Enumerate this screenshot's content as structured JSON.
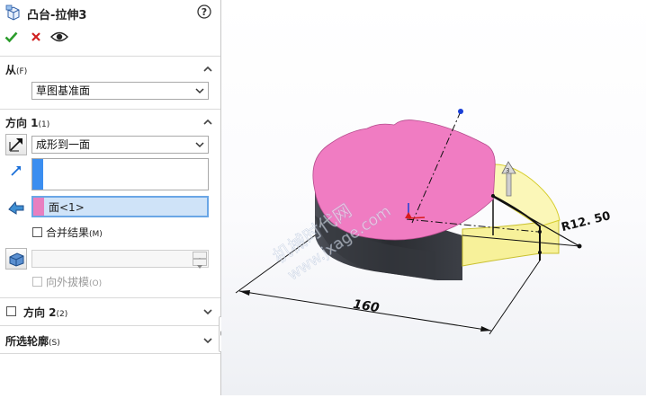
{
  "feature": {
    "title": "凸台-拉伸3",
    "help_icon": "help-circle-icon",
    "ok_icon": "checkmark-icon",
    "cancel_icon": "close-icon",
    "preview_icon": "eye-icon"
  },
  "from": {
    "label": "从",
    "shortcut": "(F)",
    "value": "草图基准面"
  },
  "direction1": {
    "label": "方向 1",
    "shortcut": "(1)",
    "end_condition": "成形到一面",
    "face_value": "面<1>",
    "merge_label": "合并结果",
    "merge_shortcut": "(M)",
    "merge_checked": false,
    "draft_label": "向外拔模",
    "draft_shortcut": "(O)",
    "draft_checked": false,
    "accent_colors": {
      "direction": "#3b8ef0",
      "face": "#e87fc0",
      "face_field_bg": "#cfe3f8"
    }
  },
  "direction2": {
    "label": "方向 2",
    "shortcut": "(2)",
    "checked": false
  },
  "contours": {
    "label": "所选轮廓",
    "shortcut": "(S)"
  },
  "graphics": {
    "dimension_length": "160",
    "dimension_radius": "R12. 50",
    "watermark_line1": "机械时代网",
    "watermark_line2": "www.jxage.com",
    "colors": {
      "top_face": "#f07cc2",
      "body": "#3a3d44",
      "selected_face": "#f7f19a",
      "dimension": "#111111"
    }
  }
}
